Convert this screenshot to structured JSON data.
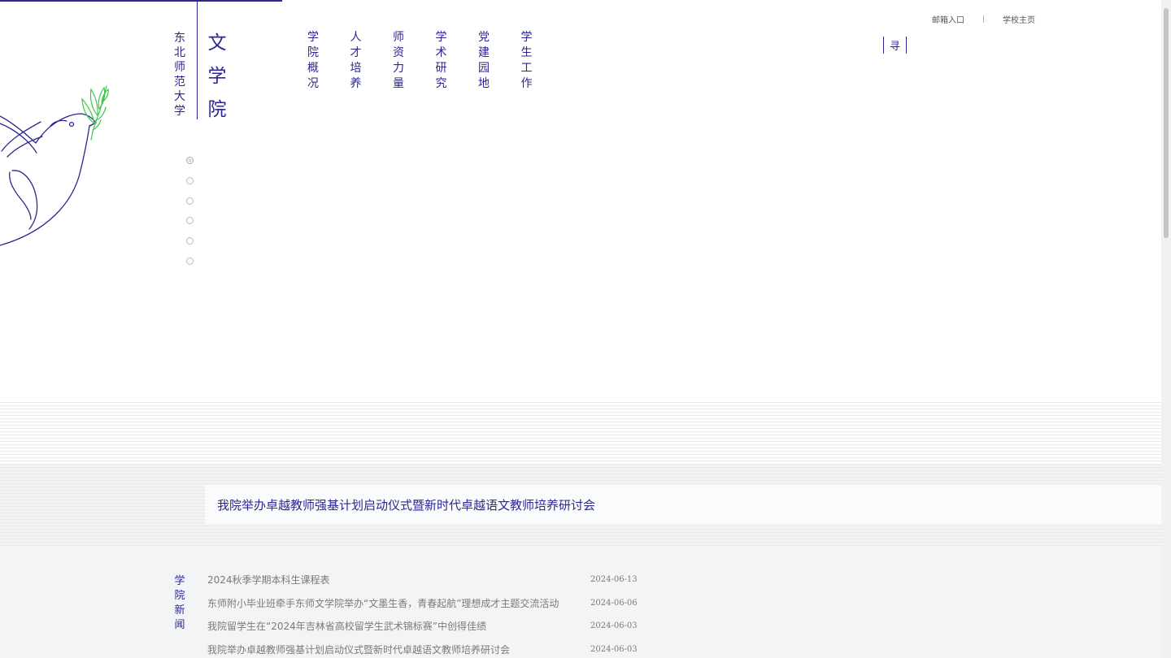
{
  "colors": {
    "brand": "#2b2692",
    "leaf": "#3ec74a",
    "muted": "#7a7a7a"
  },
  "top_links": {
    "mail": "邮箱入口",
    "separator": "|",
    "school_home": "学校主页"
  },
  "logo": {
    "university": "东北师范大学",
    "college": "文学院"
  },
  "nav": [
    {
      "label": "学院概况"
    },
    {
      "label": "人才培养"
    },
    {
      "label": "师资力量"
    },
    {
      "label": "学术研究"
    },
    {
      "label": "党建园地"
    },
    {
      "label": "学生工作"
    }
  ],
  "search": {
    "label": "寻",
    "icon": "search-icon"
  },
  "slider": {
    "dot_count": 6,
    "active_index": 0
  },
  "headline": "我院举办卓越教师强基计划启动仪式暨新时代卓越语文教师培养研讨会",
  "news": {
    "label": "学院新闻",
    "items": [
      {
        "title": "2024秋季学期本科生课程表",
        "date": "2024-06-13"
      },
      {
        "title": "东师附小毕业班牵手东师文学院举办“文墨生香，青春起航”理想成才主题交流活动",
        "date": "2024-06-06"
      },
      {
        "title": "我院留学生在“2024年吉林省高校留学生武术锦标赛”中创得佳绩",
        "date": "2024-06-03"
      },
      {
        "title": "我院举办卓越教师强基计划启动仪式暨新时代卓越语文教师培养研讨会",
        "date": "2024-06-03"
      }
    ]
  }
}
